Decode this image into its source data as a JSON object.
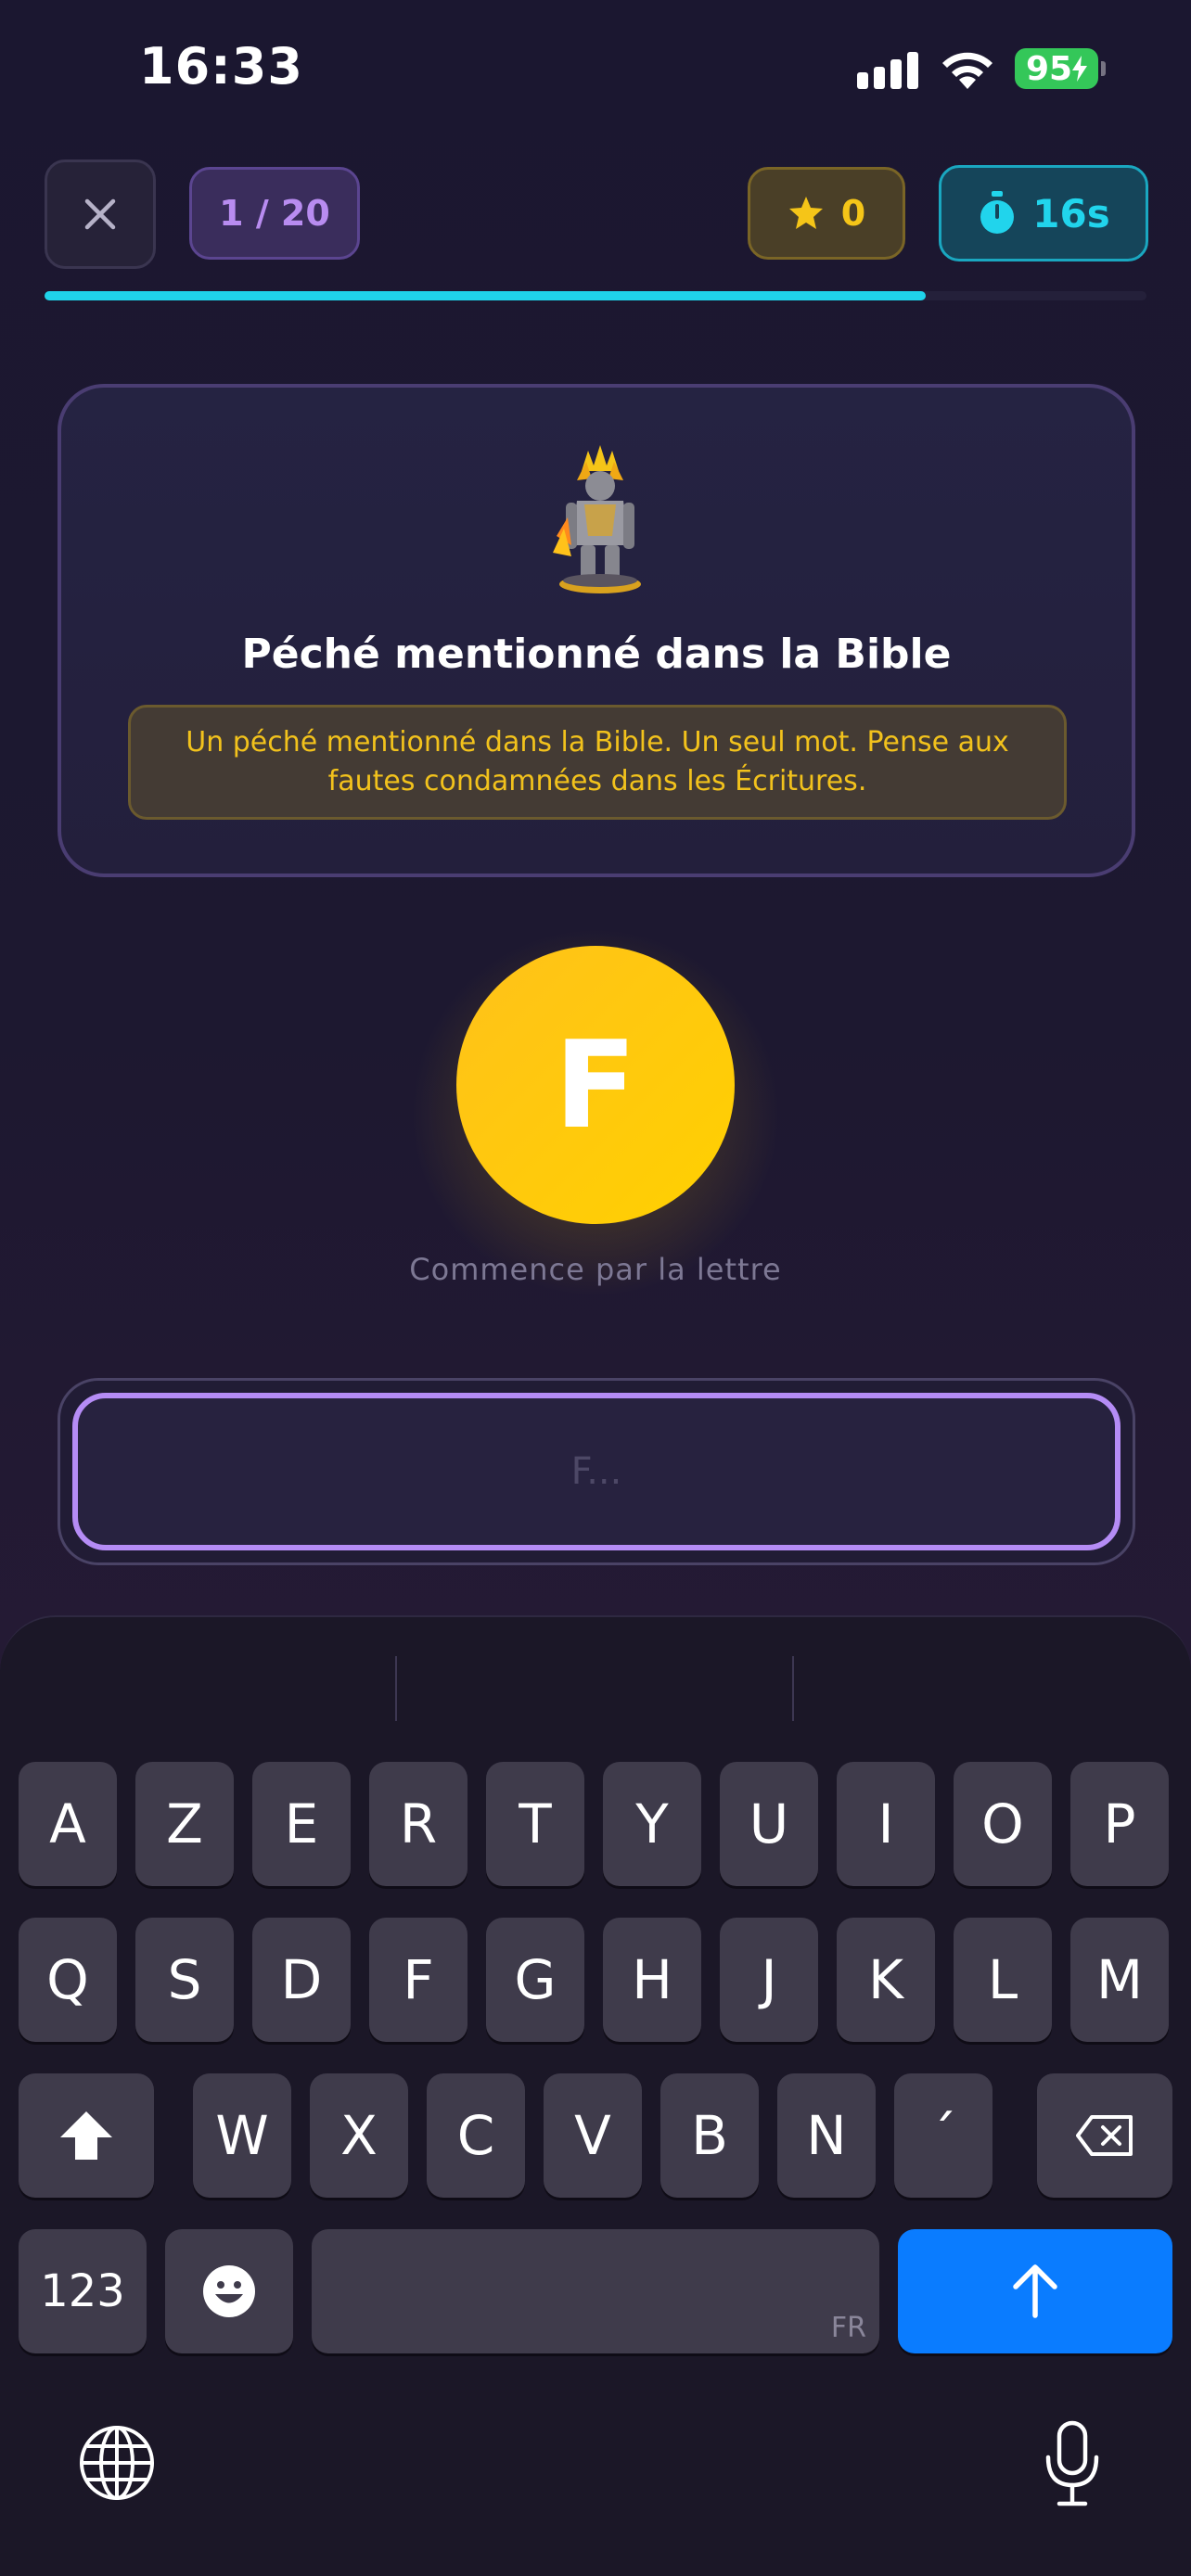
{
  "status_bar": {
    "time": "16:33",
    "battery": "95"
  },
  "top_bar": {
    "question_counter": "1 / 20",
    "score": "0",
    "timer": "16s",
    "progress": 0.8
  },
  "card": {
    "title": "Péché mentionné dans la Bible",
    "hint": "Un péché mentionné dans la Bible. Un seul mot. Pense aux fautes condamnées dans les Écritures."
  },
  "letter": {
    "value": "F",
    "caption": "Commence par la lettre"
  },
  "answer_input": {
    "placeholder": "F..."
  },
  "keyboard": {
    "row1": [
      "A",
      "Z",
      "E",
      "R",
      "T",
      "Y",
      "U",
      "I",
      "O",
      "P"
    ],
    "row2": [
      "Q",
      "S",
      "D",
      "F",
      "G",
      "H",
      "J",
      "K",
      "L",
      "M"
    ],
    "row3": [
      "W",
      "X",
      "C",
      "V",
      "B",
      "N",
      "´"
    ],
    "numbers_label": "123",
    "language_label": "FR"
  },
  "colors": {
    "accent_cyan": "#1fd3ea",
    "accent_purple": "#b58cf5",
    "accent_yellow": "#ffc21a",
    "send_blue": "#0a7cff"
  }
}
